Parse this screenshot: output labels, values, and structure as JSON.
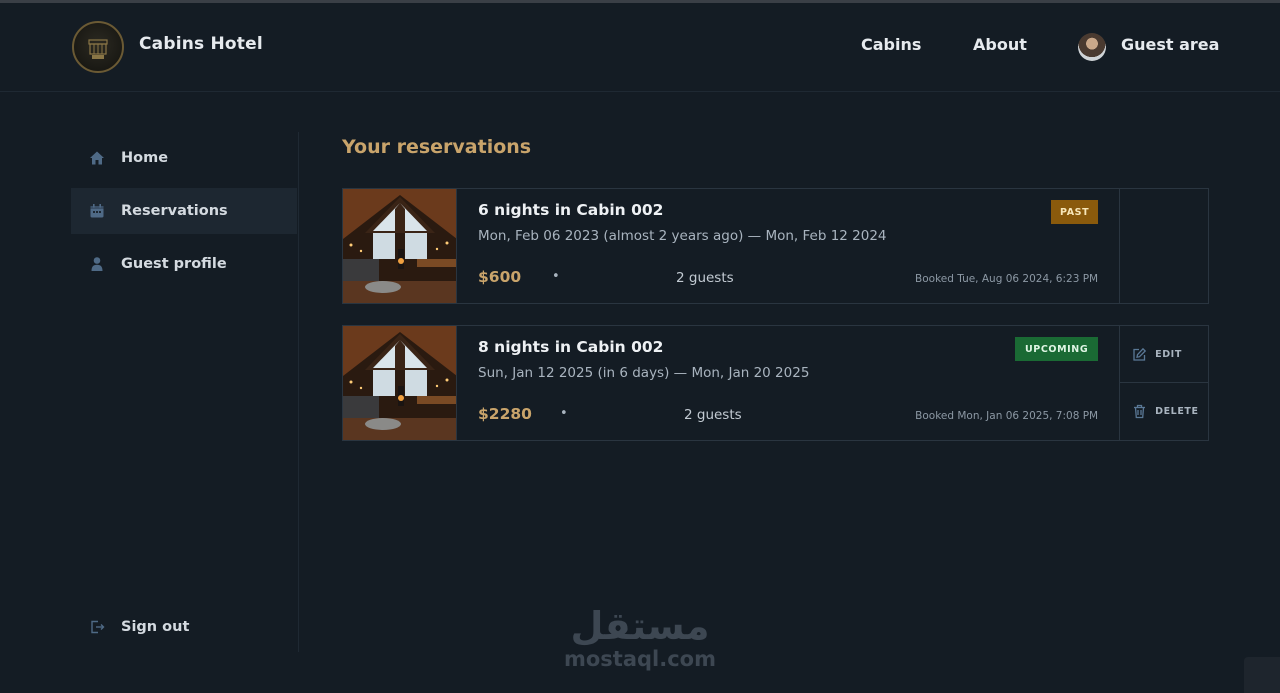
{
  "header": {
    "brand": "Cabins Hotel",
    "nav": {
      "cabins": "Cabins",
      "about": "About",
      "guest_area": "Guest area"
    }
  },
  "sidebar": {
    "items": [
      {
        "label": "Home",
        "icon": "home-icon"
      },
      {
        "label": "Reservations",
        "icon": "calendar-icon"
      },
      {
        "label": "Guest profile",
        "icon": "user-icon"
      }
    ],
    "sign_out": "Sign out"
  },
  "main": {
    "title": "Your reservations",
    "reservations": [
      {
        "title": "6 nights in Cabin 002",
        "dates": "Mon, Feb 06 2023 (almost 2 years ago) — Mon, Feb 12 2024",
        "price": "$600",
        "guests": "2 guests",
        "booked": "Booked Tue, Aug 06 2024, 6:23 PM",
        "status": "PAST"
      },
      {
        "title": "8 nights in Cabin 002",
        "dates": "Sun, Jan 12 2025 (in 6 days) — Mon, Jan 20 2025",
        "price": "$2280",
        "guests": "2 guests",
        "booked": "Booked Mon, Jan 06 2025, 7:08 PM",
        "status": "UPCOMING",
        "actions": {
          "edit": "EDIT",
          "delete": "DELETE"
        }
      }
    ]
  },
  "watermark": {
    "arabic": "مستقل",
    "latin": "mostaql.com"
  },
  "colors": {
    "background": "#141c24",
    "accent": "#c9a46b",
    "past_badge": "#8a5a0c",
    "upcoming_badge": "#1a6a34"
  }
}
